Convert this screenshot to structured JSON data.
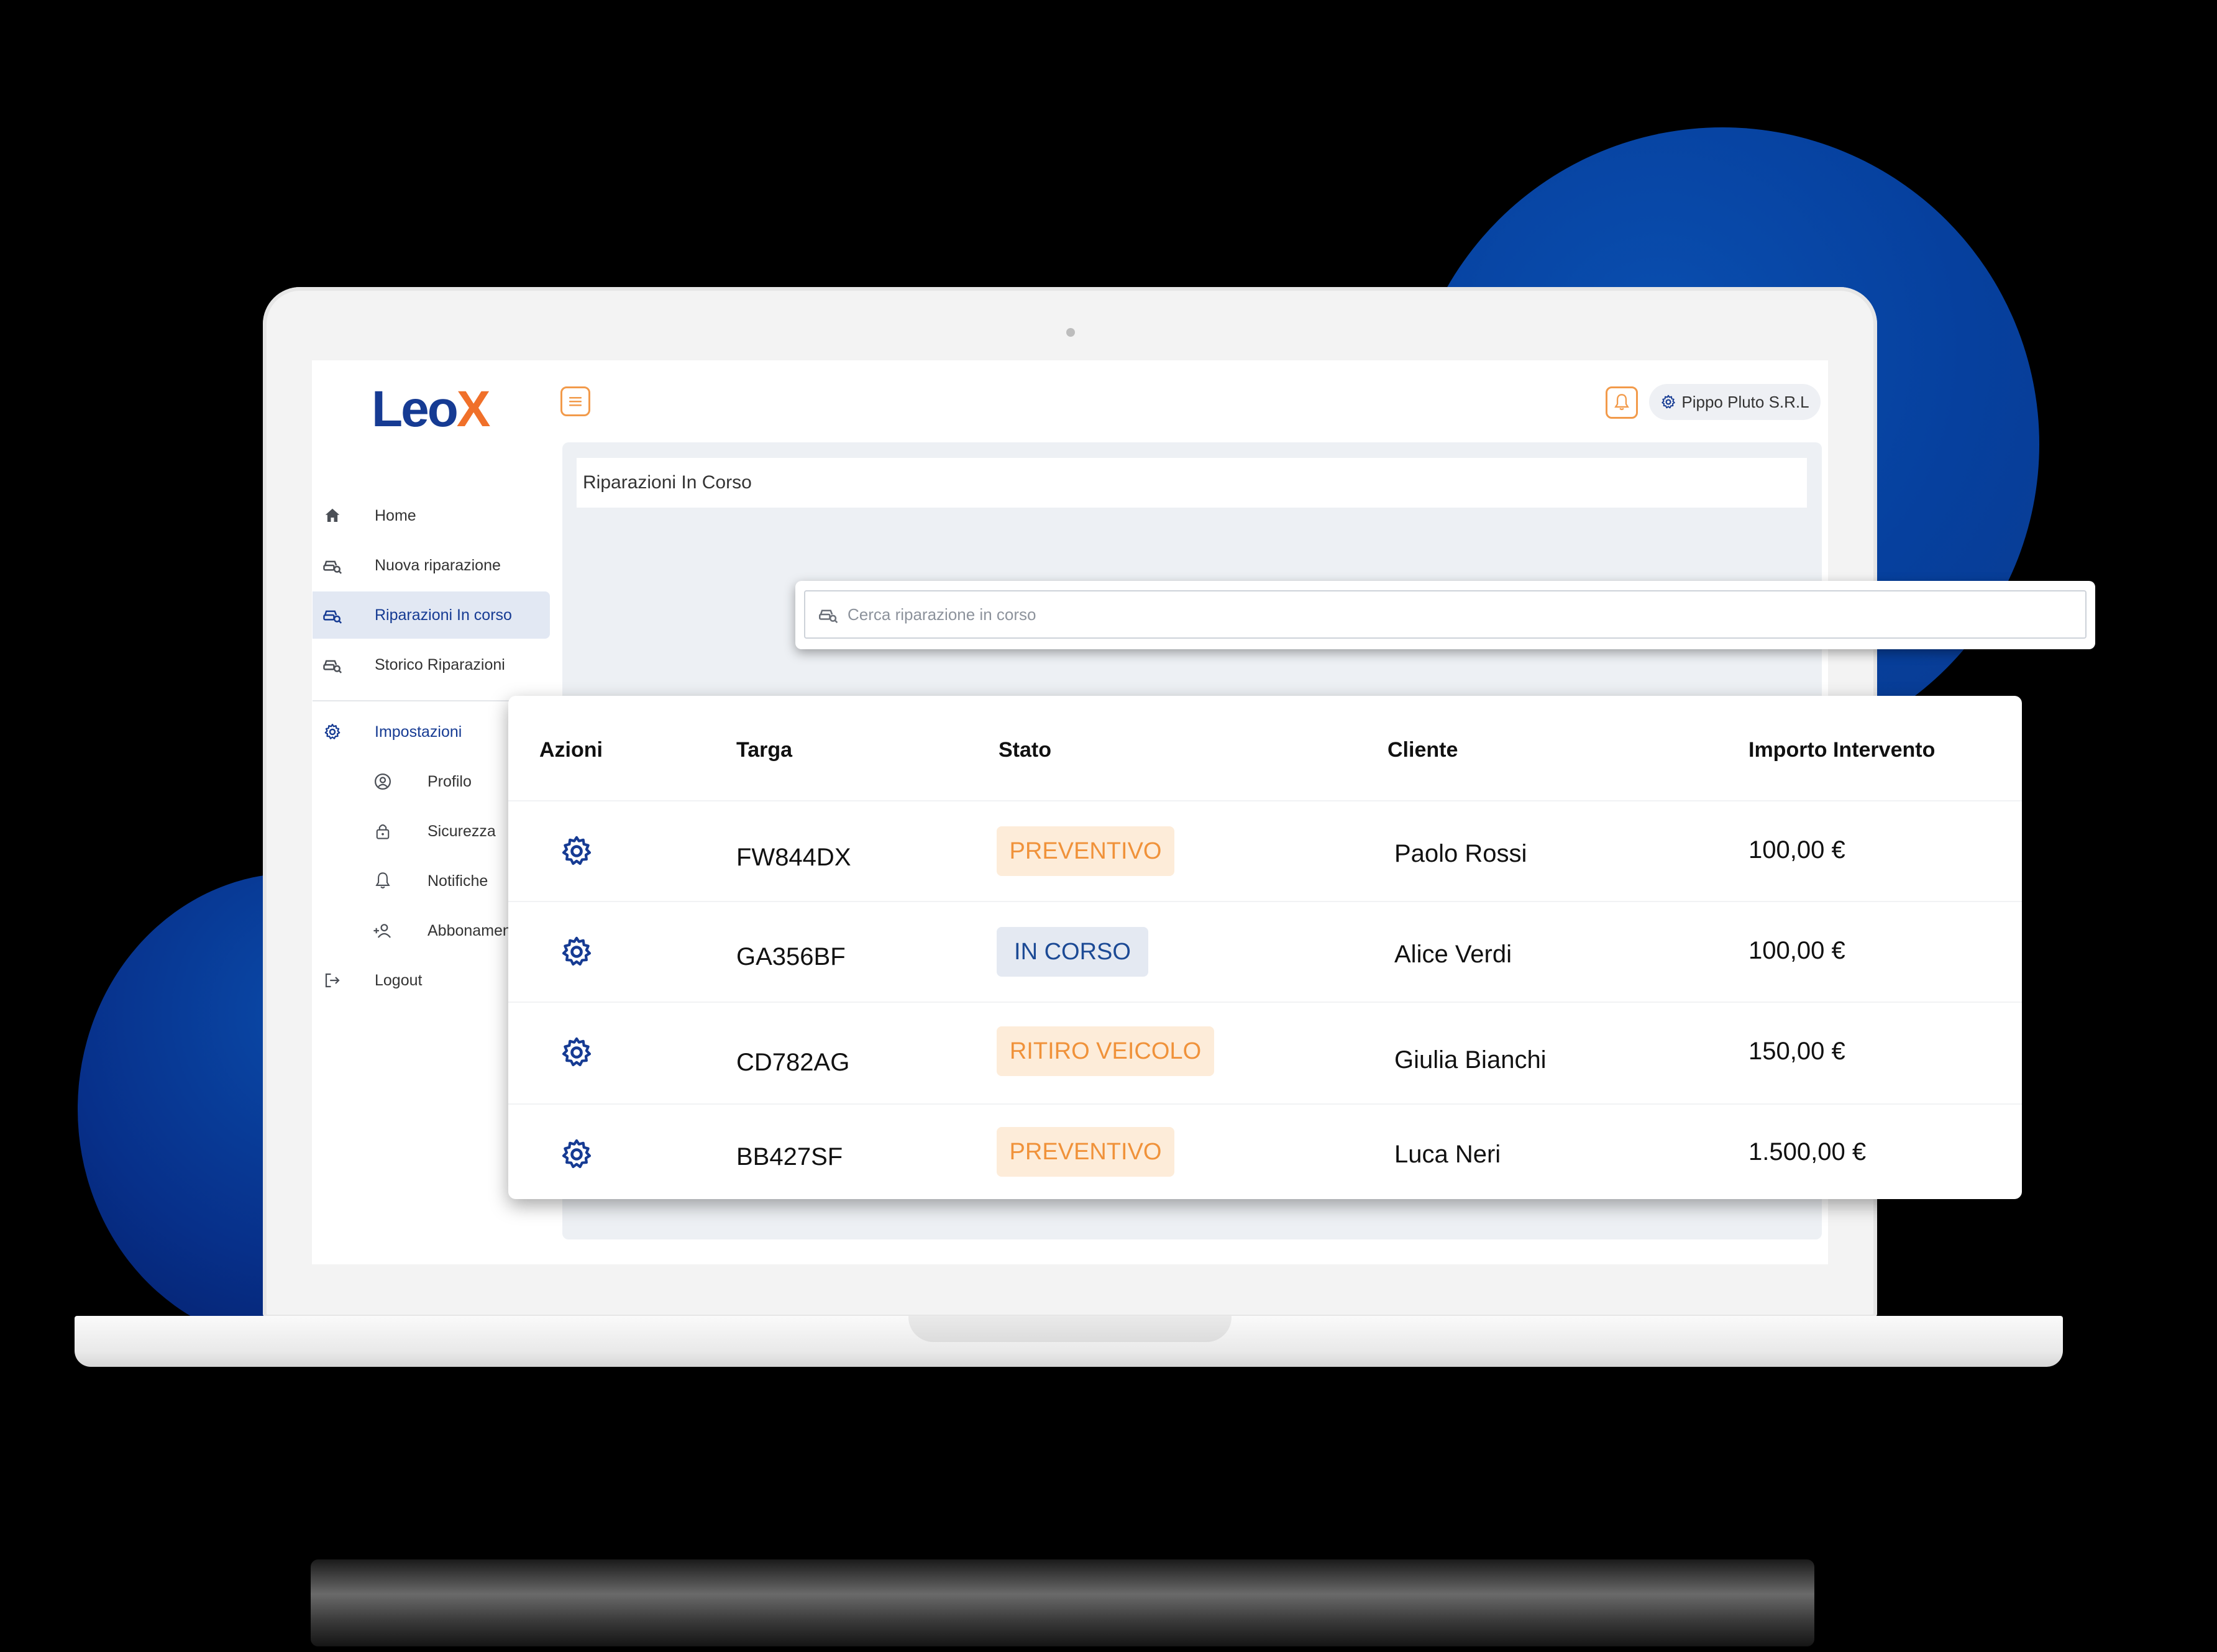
{
  "app": {
    "logo_main": "Leo",
    "logo_accent": "X"
  },
  "header": {
    "company_label": "Pippo Pluto S.R.L"
  },
  "sidebar": {
    "items": [
      {
        "label": "Home",
        "icon": "home-icon"
      },
      {
        "label": "Nuova riparazione",
        "icon": "car-search-icon"
      },
      {
        "label": "Riparazioni In corso",
        "icon": "car-search-icon",
        "active": true
      },
      {
        "label": "Storico Riparazioni",
        "icon": "car-search-icon"
      }
    ],
    "settings": {
      "label": "Impostazioni",
      "subitems": [
        {
          "label": "Profilo",
          "icon": "user-circle-icon"
        },
        {
          "label": "Sicurezza",
          "icon": "lock-icon"
        },
        {
          "label": "Notifiche",
          "icon": "bell-icon"
        },
        {
          "label": "Abbonamenti",
          "icon": "add-user-icon"
        }
      ]
    },
    "logout_label": "Logout"
  },
  "page": {
    "title": "Riparazioni In Corso"
  },
  "search": {
    "placeholder": "Cerca riparazione in corso"
  },
  "table": {
    "headers": [
      "Azioni",
      "Targa",
      "Stato",
      "Cliente",
      "Importo Intervento"
    ],
    "rows": [
      {
        "targa": "FW844DX",
        "stato": "PREVENTIVO",
        "cliente": "Paolo Rossi",
        "importo": "100,00 €"
      },
      {
        "targa": "GA356BF",
        "stato": "IN CORSO",
        "cliente": "Alice Verdi",
        "importo": "100,00 €"
      },
      {
        "targa": "CD782AG",
        "stato": "RITIRO VEICOLO",
        "cliente": "Giulia Bianchi",
        "importo": "150,00 €"
      },
      {
        "targa": "BB427SF",
        "stato": "PREVENTIVO",
        "cliente": "Luca Neri",
        "importo": "1.500,00 €"
      }
    ]
  },
  "colors": {
    "brand_blue": "#163b93",
    "brand_orange": "#f0702a",
    "badge_orange_bg": "#fdecd9",
    "badge_orange_text": "#f0923a",
    "badge_blue_bg": "#e4e9f2",
    "badge_blue_text": "#1c4a95"
  }
}
